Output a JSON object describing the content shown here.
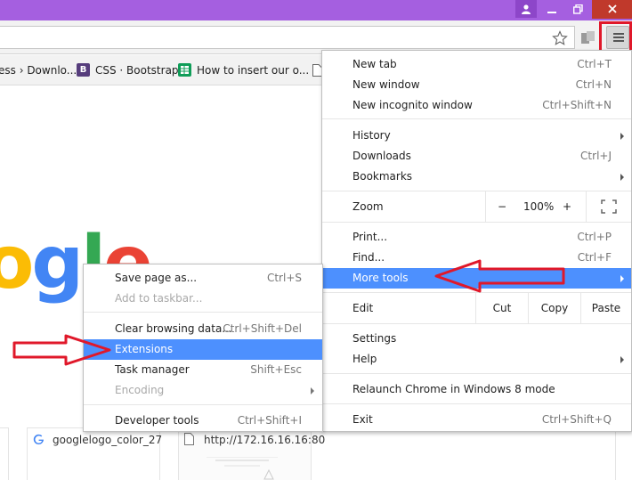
{
  "bookmarks": {
    "items": [
      {
        "label": "ess › Downlo..."
      },
      {
        "label": "CSS · Bootstrap",
        "icon_letter": "B"
      },
      {
        "label": "How to insert our o..."
      }
    ]
  },
  "logo": {
    "text": "ogle",
    "letters": [
      "o",
      "g",
      "l",
      "e"
    ]
  },
  "tiles": [
    {
      "label": "googlelogo_color_27"
    },
    {
      "label": "http://172.16.16.16:80"
    }
  ],
  "main_menu": {
    "new_tab": {
      "label": "New tab",
      "shortcut": "Ctrl+T"
    },
    "new_window": {
      "label": "New window",
      "shortcut": "Ctrl+N"
    },
    "new_incognito": {
      "label": "New incognito window",
      "shortcut": "Ctrl+Shift+N"
    },
    "history": {
      "label": "History"
    },
    "downloads": {
      "label": "Downloads",
      "shortcut": "Ctrl+J"
    },
    "bookmarks": {
      "label": "Bookmarks"
    },
    "zoom": {
      "label": "Zoom",
      "minus": "−",
      "value": "100%",
      "plus": "+"
    },
    "print": {
      "label": "Print...",
      "shortcut": "Ctrl+P"
    },
    "find": {
      "label": "Find...",
      "shortcut": "Ctrl+F"
    },
    "more_tools": {
      "label": "More tools"
    },
    "edit": {
      "label": "Edit",
      "cut": "Cut",
      "copy": "Copy",
      "paste": "Paste"
    },
    "settings": {
      "label": "Settings"
    },
    "help": {
      "label": "Help"
    },
    "relaunch": {
      "label": "Relaunch Chrome in Windows 8 mode"
    },
    "exit": {
      "label": "Exit",
      "shortcut": "Ctrl+Shift+Q"
    }
  },
  "sub_menu": {
    "save_page": {
      "label": "Save page as...",
      "shortcut": "Ctrl+S"
    },
    "add_taskbar": {
      "label": "Add to taskbar..."
    },
    "clear_data": {
      "label": "Clear browsing data...",
      "shortcut": "Ctrl+Shift+Del"
    },
    "extensions": {
      "label": "Extensions"
    },
    "task_manager": {
      "label": "Task manager",
      "shortcut": "Shift+Esc"
    },
    "encoding": {
      "label": "Encoding"
    },
    "dev_tools": {
      "label": "Developer tools",
      "shortcut": "Ctrl+Shift+I"
    }
  },
  "colors": {
    "titlebar": "#a55fe0",
    "menu_highlight": "#4d90fe",
    "annotation": "#e0182a",
    "google_blue": "#4285f4",
    "google_red": "#ea4335",
    "google_yellow": "#fbbc05",
    "google_green": "#34a853"
  },
  "icons": [
    "user-icon",
    "minimize-icon",
    "restore-icon",
    "close-icon",
    "star-icon",
    "extension-icon",
    "hamburger-menu-icon",
    "bootstrap-icon",
    "sheets-icon",
    "page-icon",
    "google-g-icon",
    "file-icon",
    "submenu-arrow-icon",
    "fullscreen-icon"
  ]
}
